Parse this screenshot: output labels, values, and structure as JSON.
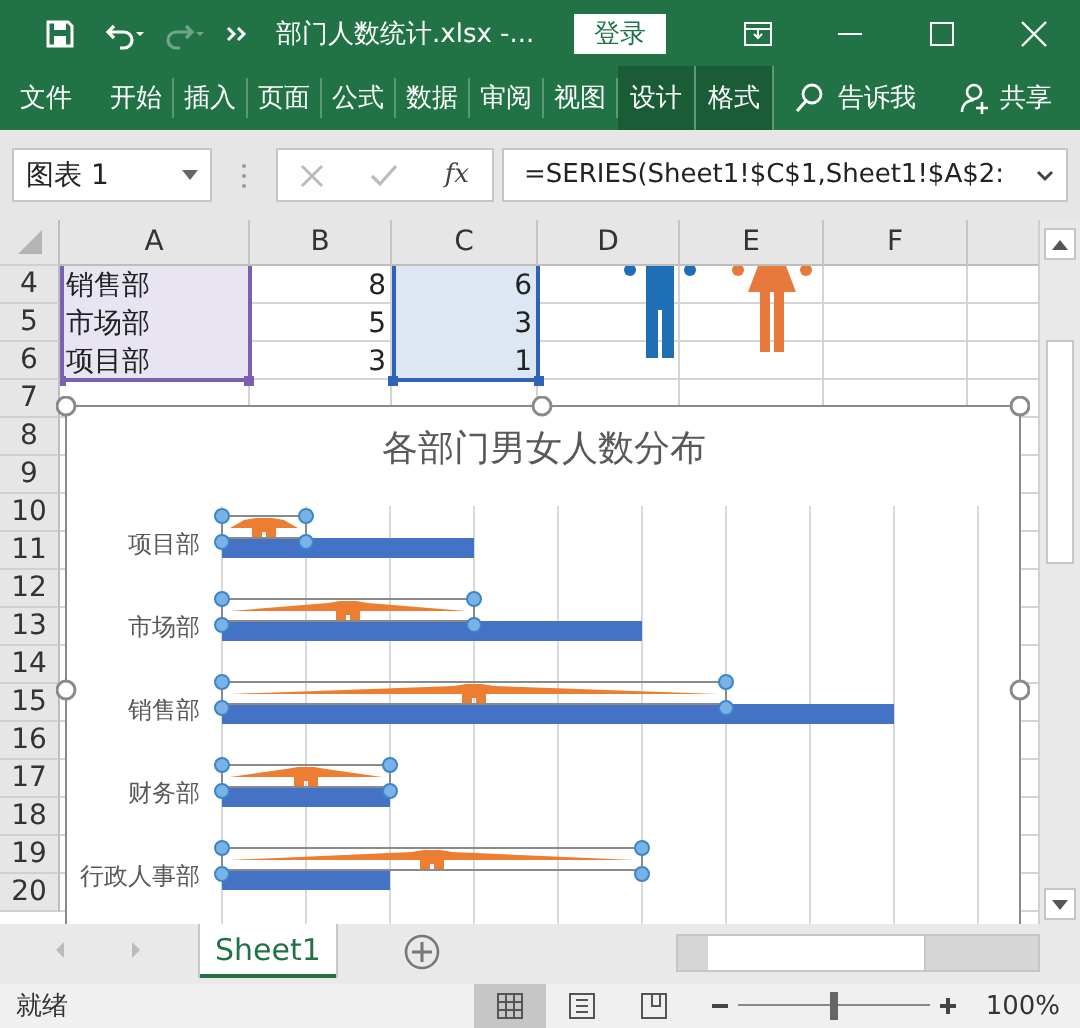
{
  "window": {
    "title": "部门人数统计.xlsx  -...",
    "login_button": "登录"
  },
  "ribbon_tabs": [
    {
      "label": "文件",
      "contextual": false
    },
    {
      "label": "开始",
      "contextual": false
    },
    {
      "label": "插入",
      "contextual": false
    },
    {
      "label": "页面",
      "contextual": false
    },
    {
      "label": "公式",
      "contextual": false
    },
    {
      "label": "数据",
      "contextual": false
    },
    {
      "label": "审阅",
      "contextual": false
    },
    {
      "label": "视图",
      "contextual": false
    },
    {
      "label": "设计",
      "contextual": true
    },
    {
      "label": "格式",
      "contextual": true
    }
  ],
  "tell_me": "告诉我",
  "share": "共享",
  "name_box": "图表 1",
  "function_button": "fx",
  "formula": "=SERIES(Sheet1!$C$1,Sheet1!$A$2:",
  "columns": [
    "A",
    "B",
    "C",
    "D",
    "E",
    "F"
  ],
  "rows": [
    {
      "number": "4",
      "cells": [
        "销售部",
        "8",
        "6"
      ]
    },
    {
      "number": "5",
      "cells": [
        "市场部",
        "5",
        "3"
      ]
    },
    {
      "number": "6",
      "cells": [
        "项目部",
        "3",
        "1"
      ]
    },
    {
      "number": "7"
    },
    {
      "number": "8"
    },
    {
      "number": "9"
    },
    {
      "number": "10"
    },
    {
      "number": "11"
    },
    {
      "number": "12"
    },
    {
      "number": "13"
    },
    {
      "number": "14"
    },
    {
      "number": "15"
    },
    {
      "number": "16"
    },
    {
      "number": "17"
    },
    {
      "number": "18"
    },
    {
      "number": "19"
    },
    {
      "number": "20"
    }
  ],
  "chart": {
    "title": "各部门男女人数分布",
    "categories": [
      "项目部",
      "市场部",
      "销售部",
      "财务部",
      "行政人事部"
    ]
  },
  "sheet_tabs": [
    {
      "label": "Sheet1",
      "selected": true
    }
  ],
  "status": "就绪",
  "view_buttons": [
    {
      "kind": "normal",
      "selected": true
    },
    {
      "kind": "page_layout",
      "selected": false
    },
    {
      "kind": "page_break",
      "selected": false
    }
  ],
  "zoom": {
    "level": 0.5,
    "reading": "100%"
  }
}
